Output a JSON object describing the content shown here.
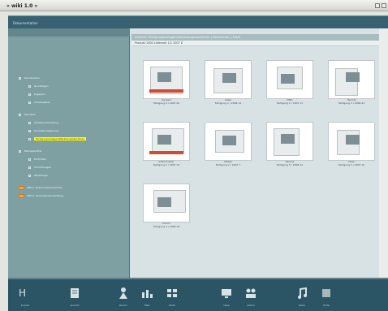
{
  "window": {
    "title": "« wiki 1.0 »"
  },
  "left_tree": {
    "items": [
      {
        "text": "Kennzeichen",
        "level": 1
      },
      {
        "text": "Grundlagen",
        "level": 2
      },
      {
        "text": "Lageplan",
        "level": 2
      },
      {
        "text": "Arbeitsplätze",
        "level": 2
      },
      {
        "text": "Kennzahl",
        "level": 1
      },
      {
        "text": "Arbeitsvorbereitung",
        "level": 2
      },
      {
        "text": "Produktionsplanung",
        "level": 2
      },
      {
        "text": "Fertigungsanlagen/Werkzeugmaschinen",
        "level": 2,
        "selected": true
      },
      {
        "text": "Betriebsmittel",
        "level": 1
      },
      {
        "text": "Prüfmittel",
        "level": 2
      },
      {
        "text": "Vorrichtungen",
        "level": 2
      },
      {
        "text": "Werkzeuge",
        "level": 2
      },
      {
        "text": "Office: Dokumente/Ansichten",
        "level": 0,
        "icon": "folder-icon"
      },
      {
        "text": "Office: Kompetenz/Ausbildung",
        "level": 0,
        "icon": "folder-icon"
      }
    ]
  },
  "content": {
    "header": "Ansicht: Fertigungsanlagen/Werkzeugmaschinen | Maschinen | 1/4/4",
    "subheader": "Produkt 1000      Lieferzeit 1/1 2007 8",
    "thumbnails": [
      {
        "label": "Heckert",
        "caption": "Fertigung 4 / 2007 20"
      },
      {
        "label": "Index",
        "caption": "Fertigung 1 / 2006 14"
      },
      {
        "label": "DMG",
        "caption": "Fertigung 2 / 2007 11"
      },
      {
        "label": "Hermle",
        "caption": "Fertigung 3 / 2006 21"
      },
      {
        "label": "Gildemeister",
        "caption": "Fertigung 5 / 2007 14"
      },
      {
        "label": "Mazak",
        "caption": "Fertigung 2 / 2007 7"
      },
      {
        "label": "Okuma",
        "caption": "Fertigung 5 / 2006 12"
      },
      {
        "label": "Haas",
        "caption": "Fertigung 1 / 2007 10"
      },
      {
        "label": "Chiron",
        "caption": "Fertigung 4 / 2006 18"
      }
    ]
  },
  "toolbar": {
    "items": [
      {
        "label": "Zurück",
        "icon": "brand-icon"
      },
      {
        "label": "Ansicht",
        "icon": "document-icon"
      },
      {
        "label": "Person",
        "icon": "person-icon"
      },
      {
        "label": "Hilfe",
        "icon": "chart-icon"
      },
      {
        "label": "Karte",
        "icon": "grid-icon"
      },
      {
        "label": "Liste",
        "icon": "monitor-icon"
      },
      {
        "label": "Aktion",
        "icon": "people-icon"
      },
      {
        "label": "Notiz",
        "icon": "music-icon"
      },
      {
        "label": "Ende",
        "icon": "box-icon"
      }
    ]
  }
}
